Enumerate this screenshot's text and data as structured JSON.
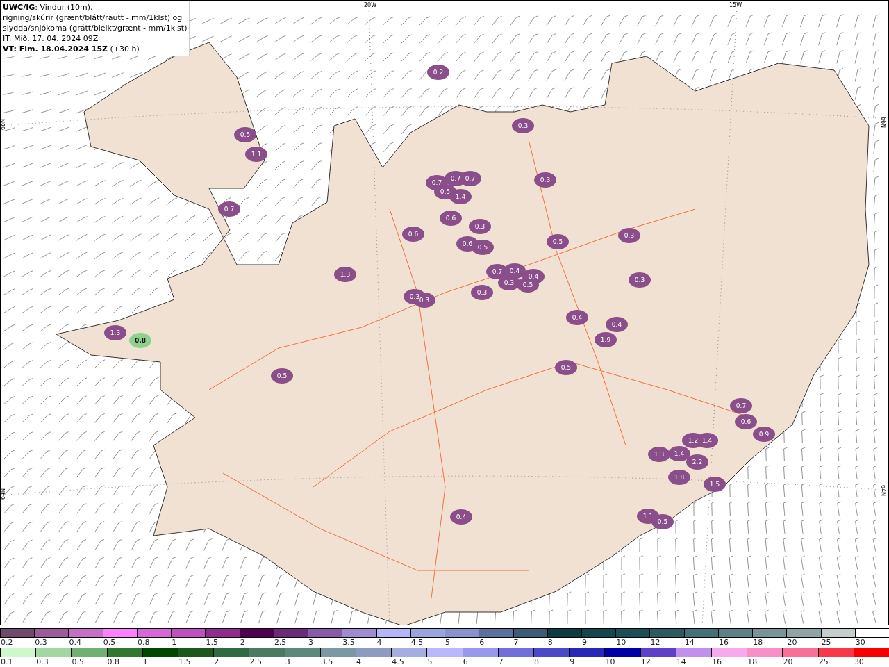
{
  "header": {
    "lines": [
      "**UWC/IG**: Vindur (10m),",
      "rigning/skúrir (grænt/blátt/rautt - mm/1klst) og",
      "slydda/snjókoma (grátt/bleikt/grænt - mm/1klst)",
      "IT: Mið. 17. 04. 2024 09Z",
      "**VT: Fim. 18.04.2024 15Z** (+30 h)"
    ]
  },
  "map": {
    "longitude_labels": [
      "20W",
      "15W"
    ],
    "latitude_labels": [
      "66N",
      "64N",
      "66N",
      "64N"
    ],
    "precipitation_values": [
      {
        "text": "0.2",
        "kind": "snow"
      },
      {
        "text": "0.5",
        "kind": "snow"
      },
      {
        "text": "1.1",
        "kind": "snow"
      },
      {
        "text": "0.7",
        "kind": "snow"
      },
      {
        "text": "1.3",
        "kind": "snow"
      },
      {
        "text": "0.3",
        "kind": "snow"
      },
      {
        "text": "0.3",
        "kind": "snow"
      },
      {
        "text": "0.3",
        "kind": "snow"
      },
      {
        "text": "0.7",
        "kind": "snow"
      },
      {
        "text": "0.5",
        "kind": "snow"
      },
      {
        "text": "1.4",
        "kind": "snow"
      },
      {
        "text": "0.7",
        "kind": "snow"
      },
      {
        "text": "0.7",
        "kind": "snow"
      },
      {
        "text": "0.6",
        "kind": "snow"
      },
      {
        "text": "0.3",
        "kind": "snow"
      },
      {
        "text": "0.6",
        "kind": "snow"
      },
      {
        "text": "0.5",
        "kind": "snow"
      },
      {
        "text": "0.7",
        "kind": "snow"
      },
      {
        "text": "0.4",
        "kind": "snow"
      },
      {
        "text": "0.3",
        "kind": "snow"
      },
      {
        "text": "0.5",
        "kind": "snow"
      },
      {
        "text": "0.4",
        "kind": "snow"
      },
      {
        "text": "0.3",
        "kind": "snow"
      },
      {
        "text": "0.3",
        "kind": "snow"
      },
      {
        "text": "0.4",
        "kind": "snow"
      },
      {
        "text": "0.4",
        "kind": "snow"
      },
      {
        "text": "1.9",
        "kind": "snow"
      },
      {
        "text": "0.5",
        "kind": "snow"
      },
      {
        "text": "0.3",
        "kind": "snow"
      },
      {
        "text": "0.3",
        "kind": "snow"
      },
      {
        "text": "0.5",
        "kind": "snow"
      },
      {
        "text": "0.4",
        "kind": "snow"
      },
      {
        "text": "1.5",
        "kind": "snow"
      },
      {
        "text": "1.8",
        "kind": "snow"
      },
      {
        "text": "2.2",
        "kind": "snow"
      },
      {
        "text": "1.4",
        "kind": "snow"
      },
      {
        "text": "1.3",
        "kind": "snow"
      },
      {
        "text": "1.2",
        "kind": "snow"
      },
      {
        "text": "1.4",
        "kind": "snow"
      },
      {
        "text": "1.1",
        "kind": "snow"
      },
      {
        "text": "0.5",
        "kind": "snow"
      },
      {
        "text": "0.7",
        "kind": "snow"
      },
      {
        "text": "0.6",
        "kind": "snow"
      },
      {
        "text": "0.9",
        "kind": "snow"
      },
      {
        "text": "0.6",
        "kind": "snow"
      },
      {
        "text": "1.3",
        "kind": "snow"
      },
      {
        "text": "0.5",
        "kind": "snow"
      },
      {
        "text": "0.8",
        "kind": "rain"
      }
    ]
  },
  "legends": [
    {
      "entries": [
        {
          "label": "0.2",
          "color": "#6e4a6e"
        },
        {
          "label": "0.3",
          "color": "#9c5c9c"
        },
        {
          "label": "0.4",
          "color": "#c76ec7"
        },
        {
          "label": "0.5",
          "color": "#ff80ff"
        },
        {
          "label": "0.8",
          "color": "#d966d9"
        },
        {
          "label": "1",
          "color": "#c050c0"
        },
        {
          "label": "1.5",
          "color": "#902c90"
        },
        {
          "label": "2",
          "color": "#500050"
        },
        {
          "label": "2.5",
          "color": "#6a2c7a"
        },
        {
          "label": "3",
          "color": "#8a5aaa"
        },
        {
          "label": "3.5",
          "color": "#a08ad0"
        },
        {
          "label": "4",
          "color": "#b4b4f8"
        },
        {
          "label": "4.5",
          "color": "#9aa4e0"
        },
        {
          "label": "5",
          "color": "#8892cc"
        },
        {
          "label": "6",
          "color": "#5c70a0"
        },
        {
          "label": "7",
          "color": "#3c5c78"
        },
        {
          "label": "8",
          "color": "#0c3c44"
        },
        {
          "label": "9",
          "color": "#144650"
        },
        {
          "label": "10",
          "color": "#1c4e58"
        },
        {
          "label": "12",
          "color": "#2c5a62"
        },
        {
          "label": "14",
          "color": "#44707a"
        },
        {
          "label": "16",
          "color": "#5c8288"
        },
        {
          "label": "18",
          "color": "#789496"
        },
        {
          "label": "20",
          "color": "#8ea4a6"
        },
        {
          "label": "25",
          "color": "#c4cccc"
        },
        {
          "label": "30",
          "color": "#ffffff"
        }
      ]
    },
    {
      "entries": [
        {
          "label": "0.1",
          "color": "#ccf8cc"
        },
        {
          "label": "0.3",
          "color": "#a0d8a0"
        },
        {
          "label": "0.5",
          "color": "#70b070"
        },
        {
          "label": "0.8",
          "color": "#307830"
        },
        {
          "label": "1",
          "color": "#004800"
        },
        {
          "label": "1.5",
          "color": "#1c581c"
        },
        {
          "label": "2",
          "color": "#306a40"
        },
        {
          "label": "2.5",
          "color": "#4a7a62"
        },
        {
          "label": "3",
          "color": "#5a8a7c"
        },
        {
          "label": "3.5",
          "color": "#7c98a4"
        },
        {
          "label": "4",
          "color": "#8c9cc0"
        },
        {
          "label": "4.5",
          "color": "#a4aee0"
        },
        {
          "label": "5",
          "color": "#b8b8fc"
        },
        {
          "label": "6",
          "color": "#9898ec"
        },
        {
          "label": "7",
          "color": "#7070d8"
        },
        {
          "label": "8",
          "color": "#4a4ac8"
        },
        {
          "label": "9",
          "color": "#2828b8"
        },
        {
          "label": "10",
          "color": "#0000a8"
        },
        {
          "label": "12",
          "color": "#6040c8"
        },
        {
          "label": "14",
          "color": "#c090ec"
        },
        {
          "label": "16",
          "color": "#f8a8ec"
        },
        {
          "label": "18",
          "color": "#f890c8"
        },
        {
          "label": "20",
          "color": "#f87098"
        },
        {
          "label": "25",
          "color": "#f83848"
        },
        {
          "label": "30",
          "color": "#f80000"
        }
      ]
    }
  ]
}
